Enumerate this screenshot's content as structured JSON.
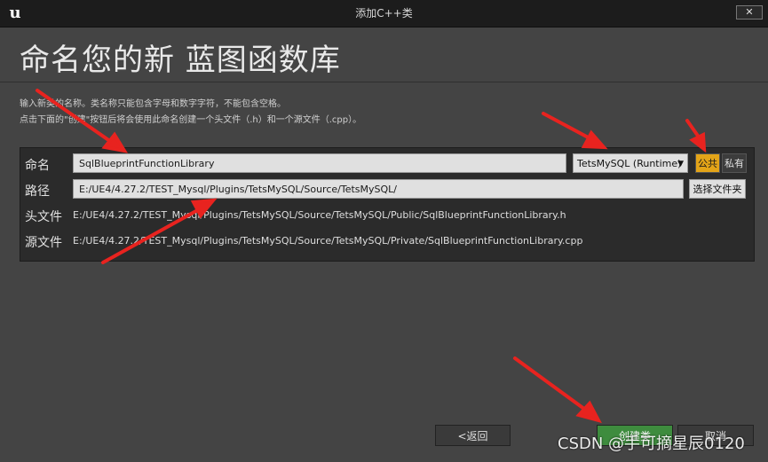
{
  "window": {
    "title": "添加C++类",
    "close_label": "✕"
  },
  "page": {
    "title": "命名您的新 蓝图函数库",
    "desc_line1": "输入新类的名称。类名称只能包含字母和数字字符，不能包含空格。",
    "desc_line2": "点击下面的\"创建\"按钮后将会使用此命名创建一个头文件（.h）和一个源文件（.cpp）。"
  },
  "form": {
    "name_label": "命名",
    "name_value": "SqlBlueprintFunctionLibrary",
    "module_value": "TetsMySQL (Runtime)",
    "public_label": "公共",
    "private_label": "私有",
    "path_label": "路径",
    "path_value": "E:/UE4/4.27.2/TEST_Mysql/Plugins/TetsMySQL/Source/TetsMySQL/",
    "choose_folder_label": "选择文件夹",
    "header_label": "头文件",
    "header_value": "E:/UE4/4.27.2/TEST_Mysql/Plugins/TetsMySQL/Source/TetsMySQL/Public/SqlBlueprintFunctionLibrary.h",
    "source_label": "源文件",
    "source_value": "E:/UE4/4.27.2/TEST_Mysql/Plugins/TetsMySQL/Source/TetsMySQL/Private/SqlBlueprintFunctionLibrary.cpp"
  },
  "buttons": {
    "back": "<返回",
    "create": "创建类",
    "cancel": "取消"
  },
  "watermark": "CSDN @手可摘星辰0120",
  "colors": {
    "accent_public": "#e3a418",
    "create_button": "#3e8c3e",
    "annotation_arrow": "#e8231f"
  }
}
